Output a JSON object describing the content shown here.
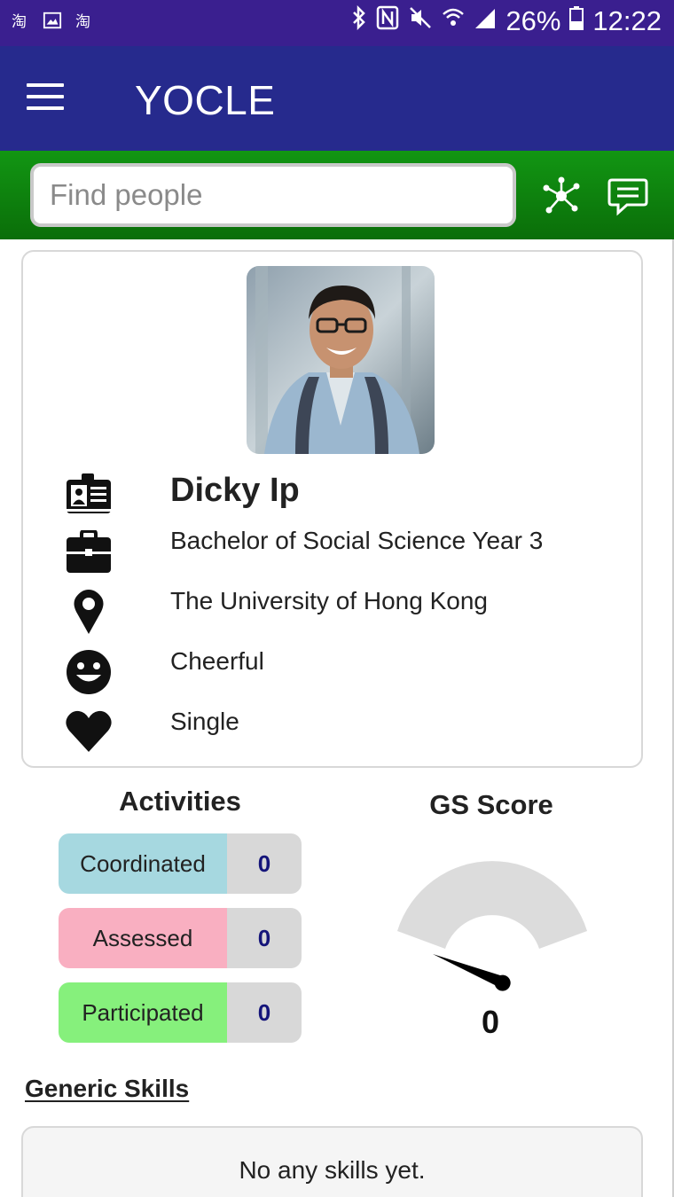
{
  "status_bar": {
    "battery": "26%",
    "time": "12:22",
    "left_icons": [
      "taobao-icon",
      "image-icon",
      "taobao-icon"
    ],
    "right_icons": [
      "bluetooth-icon",
      "nfc-icon",
      "mute-icon",
      "wifi-icon",
      "signal-icon",
      "battery-icon"
    ]
  },
  "app_bar": {
    "title": "YOCLE",
    "menu_icon": "hamburger-menu-icon"
  },
  "search": {
    "placeholder": "Find people",
    "value": "",
    "network_icon": "network-icon",
    "chat_icon": "chat-icon"
  },
  "profile": {
    "name": "Dicky Ip",
    "programme": "Bachelor of Social Science Year 3",
    "institution": "The University of Hong Kong",
    "personality": "Cheerful",
    "relationship": "Single"
  },
  "activities": {
    "title": "Activities",
    "items": [
      {
        "label": "Coordinated",
        "count": "0",
        "color": "#a6d8e0"
      },
      {
        "label": "Assessed",
        "count": "0",
        "color": "#f9afc1"
      },
      {
        "label": "Participated",
        "count": "0",
        "color": "#86f07c"
      }
    ]
  },
  "gs_score": {
    "title": "GS Score",
    "value": "0",
    "fraction": 0
  },
  "generic_skills": {
    "title": "Generic Skills",
    "empty_text": "No any skills yet."
  }
}
